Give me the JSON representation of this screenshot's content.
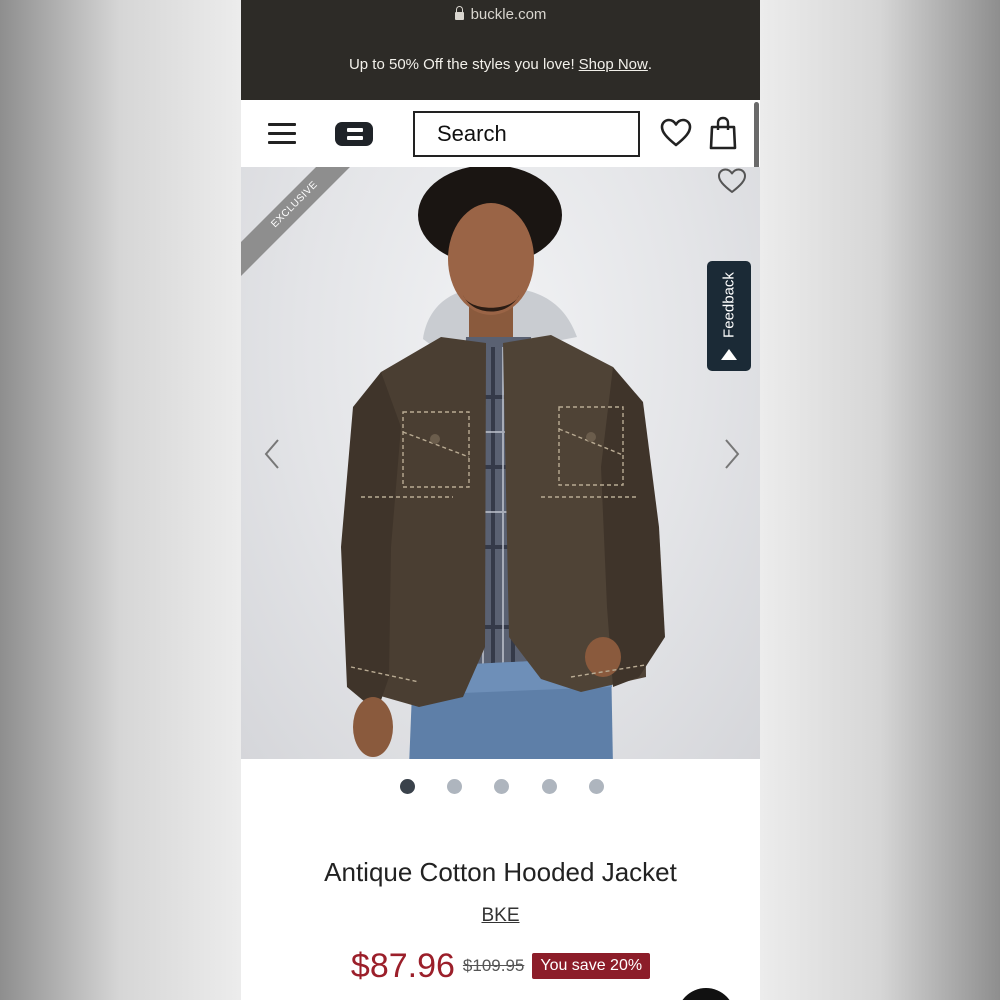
{
  "browser": {
    "url": "buckle.com"
  },
  "promo": {
    "text": "Up to 50% Off the styles you love!",
    "link": "Shop Now",
    "trailing": "."
  },
  "header": {
    "search_placeholder": "Search",
    "menu_icon": "hamburger-icon",
    "logo_icon": "buckle-logo",
    "wishlist_icon": "heart-icon",
    "bag_icon": "shopping-bag-icon"
  },
  "gallery": {
    "badge": "EXCLUSIVE",
    "feedback_label": "Feedback",
    "image_description": "Model wearing brown hooded jacket over plaid shirt and jeans",
    "image_count": 5,
    "active_index": 0
  },
  "product": {
    "title": "Antique Cotton Hooded Jacket",
    "brand": "BKE",
    "price": "$87.96",
    "original_price": "$109.95",
    "savings": "You save 20%"
  },
  "colors": {
    "top_bar": "#2d2b27",
    "price": "#9b1f2a",
    "savings_badge": "#8c1d29",
    "feedback": "#1b2a36"
  }
}
